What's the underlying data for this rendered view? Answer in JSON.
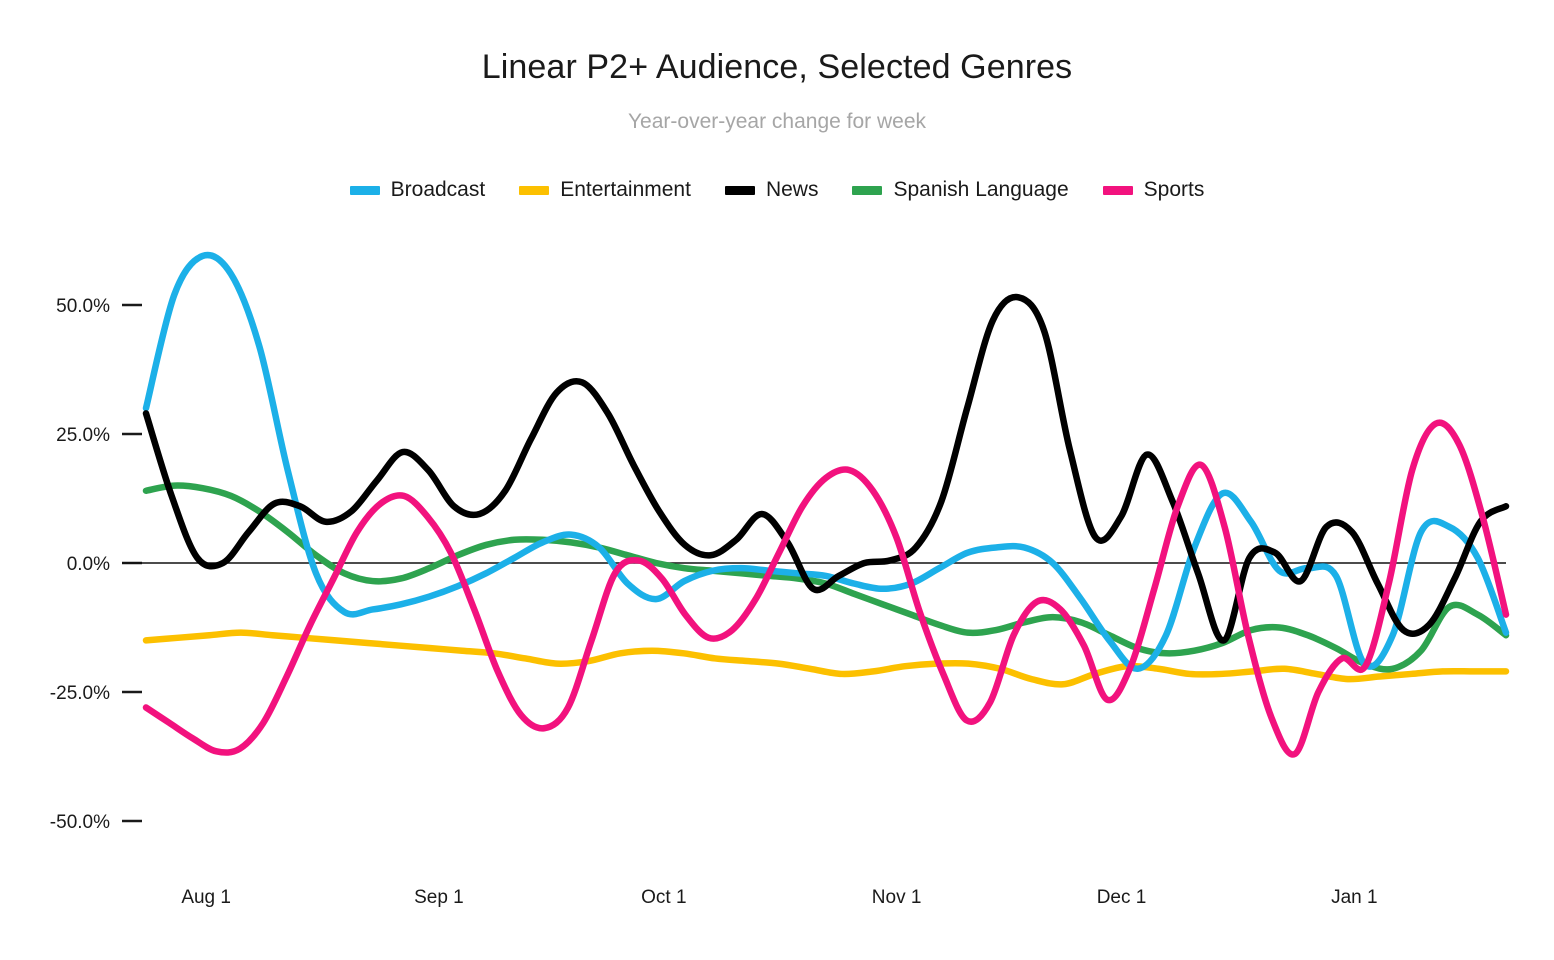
{
  "chart_data": {
    "type": "line",
    "title": "Linear P2+ Audience, Selected Genres",
    "subtitle": "Year-over-year change for week",
    "xlabel": "",
    "ylabel": "",
    "ylim": [
      -62,
      64
    ],
    "xlim": [
      0,
      26
    ],
    "grid": false,
    "zero_line": true,
    "legend_position": "top-center",
    "y_ticks": [
      50,
      25,
      0,
      -25,
      -50
    ],
    "y_tick_labels": [
      "50.0%",
      "25.0%",
      "0.0%",
      "-25.0%",
      "-50.0%"
    ],
    "x_ticks": [
      1.15,
      5.6,
      9.9,
      14.35,
      18.65,
      23.1
    ],
    "x_tick_labels": [
      "Aug 1",
      "Sep 1",
      "Oct 1",
      "Nov 1",
      "Dec 1",
      "Jan 1"
    ],
    "x": [
      0,
      0.6,
      1.2,
      1.8,
      2.4,
      3.0,
      3.6,
      4.2,
      4.8,
      5.4,
      6.0,
      6.6,
      7.2,
      7.8,
      8.4,
      9.0,
      9.6,
      10.2,
      10.8,
      11.4,
      12.0,
      12.6,
      13.2,
      13.8,
      14.4,
      15.0,
      15.6,
      16.2,
      16.8,
      17.4,
      18.0,
      18.6,
      19.2,
      19.8,
      20.4,
      21.0,
      21.6,
      22.2,
      22.8,
      23.4,
      24.0,
      24.6,
      25.2,
      26.0
    ],
    "series": [
      {
        "name": "Broadcast",
        "color": "#1cb0e8",
        "values": [
          30,
          52,
          59.5,
          56,
          42,
          18,
          -2,
          -9.5,
          -9,
          -8,
          -6.5,
          -4.5,
          -2,
          1,
          4,
          5.5,
          3,
          -4,
          -7,
          -3.5,
          -1.5,
          -1,
          -1.5,
          -2,
          -2.5,
          -4,
          -5,
          -4,
          -1,
          2,
          3,
          3,
          0,
          -7,
          -15,
          -20.5,
          -14,
          3,
          13.5,
          8,
          -1.5,
          -1,
          -2.5,
          -19.5,
          -14,
          6,
          7,
          1,
          -13.5
        ]
      },
      {
        "name": "Entertainment",
        "color": "#fcc000",
        "values": [
          -15,
          -14.5,
          -14,
          -13.5,
          -14,
          -14.5,
          -15,
          -15.5,
          -16,
          -16.5,
          -17,
          -17.5,
          -18.5,
          -19.5,
          -19,
          -17.5,
          -17,
          -17.5,
          -18.5,
          -19,
          -19.5,
          -20.5,
          -21.5,
          -21,
          -20,
          -19.5,
          -19.5,
          -20.5,
          -22.5,
          -23.5,
          -21.5,
          -20,
          -20.5,
          -21.5,
          -21.5,
          -21,
          -20.5,
          -21.5,
          -22.5,
          -22,
          -21.5,
          -21,
          -21,
          -21
        ]
      },
      {
        "name": "News",
        "color": "#000000",
        "values": [
          29,
          13,
          1,
          0,
          6,
          11.5,
          11,
          8,
          10,
          16,
          21.5,
          18,
          11,
          9.5,
          14,
          24,
          33,
          35,
          29,
          19,
          10,
          3.5,
          1.5,
          4.5,
          9.5,
          4,
          -5,
          -2.5,
          0,
          0.5,
          3,
          12,
          30,
          47,
          51.5,
          45,
          22,
          5,
          9,
          21,
          12,
          -2,
          -15,
          1,
          2,
          -3.5,
          7,
          6,
          -4,
          -13,
          -12,
          -3,
          8,
          11
        ]
      },
      {
        "name": "Spanish Language",
        "color": "#2ea34f",
        "values": [
          14,
          15,
          14.5,
          13,
          10,
          6,
          1.5,
          -2,
          -3.5,
          -3,
          -1,
          1.5,
          3.5,
          4.5,
          4.5,
          4,
          3,
          1.5,
          0,
          -1,
          -1.5,
          -2,
          -2.5,
          -3,
          -4,
          -6,
          -8,
          -10,
          -12,
          -13.5,
          -13,
          -11.5,
          -10.5,
          -11.5,
          -14,
          -16.5,
          -17.5,
          -17,
          -15.5,
          -13,
          -12.5,
          -14,
          -16.5,
          -19.5,
          -20.5,
          -17,
          -8.5,
          -10,
          -14
        ]
      },
      {
        "name": "Sports",
        "color": "#f2127e",
        "values": [
          -28,
          -31,
          -34,
          -36.5,
          -36,
          -31,
          -22,
          -12,
          -3,
          6,
          11.5,
          13,
          9,
          2,
          -9,
          -21,
          -29.5,
          -32,
          -28,
          -15,
          -2,
          0.5,
          -3,
          -10,
          -14.5,
          -13,
          -7,
          2,
          11,
          16.5,
          18,
          14,
          5,
          -9.5,
          -21.5,
          -30.5,
          -27,
          -14,
          -7.5,
          -9,
          -16,
          -26.5,
          -20,
          -5,
          11,
          19,
          7,
          -14,
          -30,
          -37,
          -25,
          -18.5,
          -20,
          -4,
          18,
          27,
          23,
          9,
          -10
        ]
      }
    ]
  },
  "legend": {
    "items": [
      {
        "label": "Broadcast",
        "color": "#1cb0e8",
        "icon": "line-swatch"
      },
      {
        "label": "Entertainment",
        "color": "#fcc000",
        "icon": "line-swatch"
      },
      {
        "label": "News",
        "color": "#000000",
        "icon": "line-swatch"
      },
      {
        "label": "Spanish Language",
        "color": "#2ea34f",
        "icon": "line-swatch"
      },
      {
        "label": "Sports",
        "color": "#f2127e",
        "icon": "line-swatch"
      }
    ]
  }
}
